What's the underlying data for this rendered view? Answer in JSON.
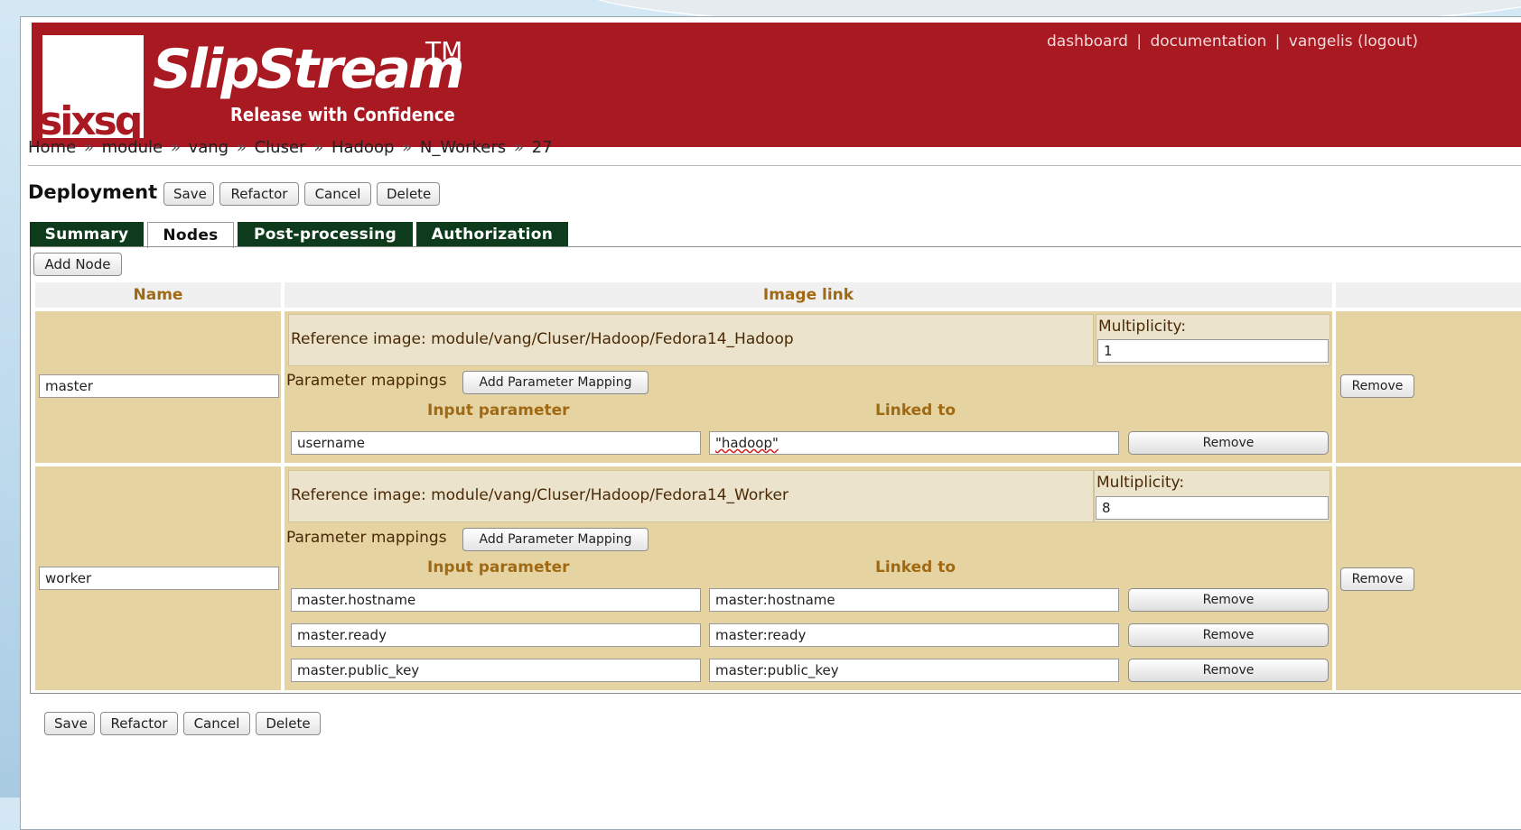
{
  "header": {
    "logo_text": "sixsq",
    "brand_name": "SlipStream",
    "brand_tm": "TM",
    "tagline": "Release with Confidence",
    "nav": {
      "dashboard": "dashboard",
      "documentation": "documentation",
      "user": "vangelis",
      "logout": "(logout)",
      "separator": "|"
    }
  },
  "breadcrumb": {
    "items": [
      "Home",
      "module",
      "vang",
      "Cluser",
      "Hadoop",
      "N_Workers",
      "27"
    ],
    "separator": "»"
  },
  "page": {
    "title": "Deployment"
  },
  "actions": {
    "save": "Save",
    "refactor": "Refactor",
    "cancel": "Cancel",
    "delete": "Delete"
  },
  "tabs": [
    {
      "label": "Summary",
      "active": false
    },
    {
      "label": "Nodes",
      "active": true
    },
    {
      "label": "Post-processing",
      "active": false
    },
    {
      "label": "Authorization",
      "active": false
    }
  ],
  "nodes_panel": {
    "add_node_label": "Add Node",
    "columns": {
      "name": "Name",
      "image_link": "Image link"
    },
    "multiplicity_label": "Multiplicity:",
    "param_mappings_label": "Parameter mappings",
    "add_mapping_label": "Add Parameter Mapping",
    "input_param_header": "Input parameter",
    "linked_to_header": "Linked to",
    "remove_label": "Remove",
    "nodes": [
      {
        "name": "master",
        "reference_image": "Reference image: module/vang/Cluser/Hadoop/Fedora14_Hadoop",
        "multiplicity": "1",
        "mappings": [
          {
            "input": "username",
            "linked": "\"hadoop\""
          }
        ]
      },
      {
        "name": "worker",
        "reference_image": "Reference image: module/vang/Cluser/Hadoop/Fedora14_Worker",
        "multiplicity": "8",
        "mappings": [
          {
            "input": "master.hostname",
            "linked": "master:hostname"
          },
          {
            "input": "master.ready",
            "linked": "master:ready"
          },
          {
            "input": "master.public_key",
            "linked": "master:public_key"
          }
        ]
      }
    ]
  },
  "colors": {
    "header_red": "#a91922",
    "tab_green": "#0e3b1c",
    "row_tan": "#e6d3a2",
    "header_text_gold": "#a06a14"
  }
}
